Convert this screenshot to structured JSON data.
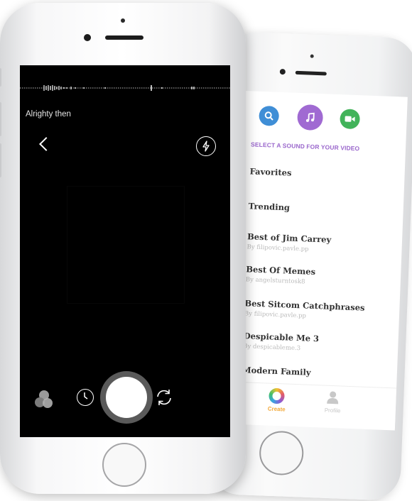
{
  "recording_screen": {
    "caption": "Alrighty then",
    "icons": {
      "back": "chevron-left-icon",
      "flash": "flash-icon",
      "filters": "filters-icon",
      "timer": "timer-icon",
      "flip": "flip-camera-icon",
      "shutter": "record-button"
    }
  },
  "sound_screen": {
    "section_title": "SELECT A SOUND FOR YOUR VIDEO",
    "top_icons": [
      "search-icon",
      "music-icon",
      "video-icon"
    ],
    "items": [
      {
        "title": "Favorites",
        "subtitle": ""
      },
      {
        "title": "Trending",
        "subtitle": ""
      },
      {
        "title": "Best of Jim Carrey",
        "subtitle": "By filipovic.pavle.pp"
      },
      {
        "title": "Best Of Memes",
        "subtitle": "By angelsturntosk8"
      },
      {
        "title": "Best Sitcom Catchphrases",
        "subtitle": "By filipovic.pavle.pp"
      },
      {
        "title": "Despicable Me 3",
        "subtitle": "By despicableme.3"
      },
      {
        "title": "Modern Family",
        "subtitle": ""
      }
    ],
    "tabs": [
      {
        "label": "Create",
        "color": "#f2a93b"
      },
      {
        "label": "Profile",
        "color": "#cccccc"
      }
    ]
  }
}
